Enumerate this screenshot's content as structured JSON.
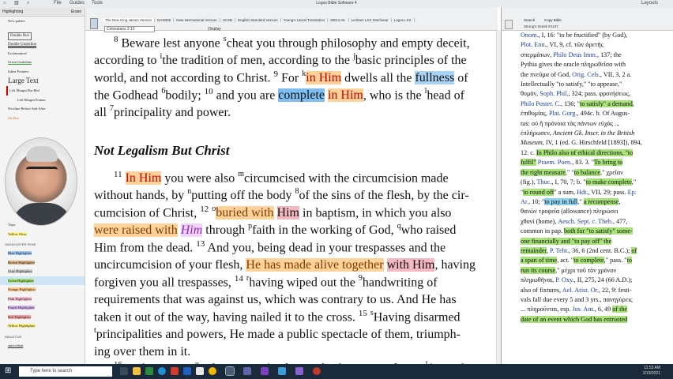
{
  "window": {
    "title": "Logos Bible Software 4"
  },
  "toolbar": {
    "menu": [
      "File",
      "Guides",
      "Tools"
    ],
    "layouts": "Layouts"
  },
  "left_panel": {
    "tab": "Highlighting",
    "erase": "Erase",
    "styles": [
      "New palette",
      "Double Box",
      "Double Underline",
      "Exclamation!",
      "Green Underline",
      "Inline Pointers",
      "Large Text",
      "Left Margin Bar Red",
      "Left Margin Pointer",
      "Newline Before And After",
      "On Fire"
    ],
    "more_styles": [
      "Trips",
      "Yellow Glow"
    ],
    "highlighter_section": "HIGHLIGHTER PENS",
    "pens": [
      "Blue Highlighter",
      "Brown Highlighter",
      "Gray Highlighter",
      "Green Highlighter",
      "Orange Highlighter",
      "Pink Highlighter",
      "Purple Highlighter",
      "Red Highlighter",
      "Yellow Highlighter"
    ],
    "inductive_section": "INDUCTIVE",
    "inductive_item": "antecedent"
  },
  "tabs": [
    "The New King James Version",
    "NASB95",
    "New International Version",
    "HCSB",
    "English Standard Version",
    "Young's Literal Translation",
    "SBG4 Int.",
    "Lexham LXX Interlinear",
    "Logos LXX"
  ],
  "reference": "Colossians 2:10",
  "display_label": "Display",
  "doc": {
    "heading": "Not Legalism But Christ"
  },
  "right_panel": {
    "tabs": [
      "Search",
      "Copy Bible"
    ],
    "resource": "Strong's Greek #4137"
  },
  "taskbar": {
    "search_placeholder": "Type here to search",
    "time": "11:53 AM",
    "date": "2/19/2021"
  }
}
